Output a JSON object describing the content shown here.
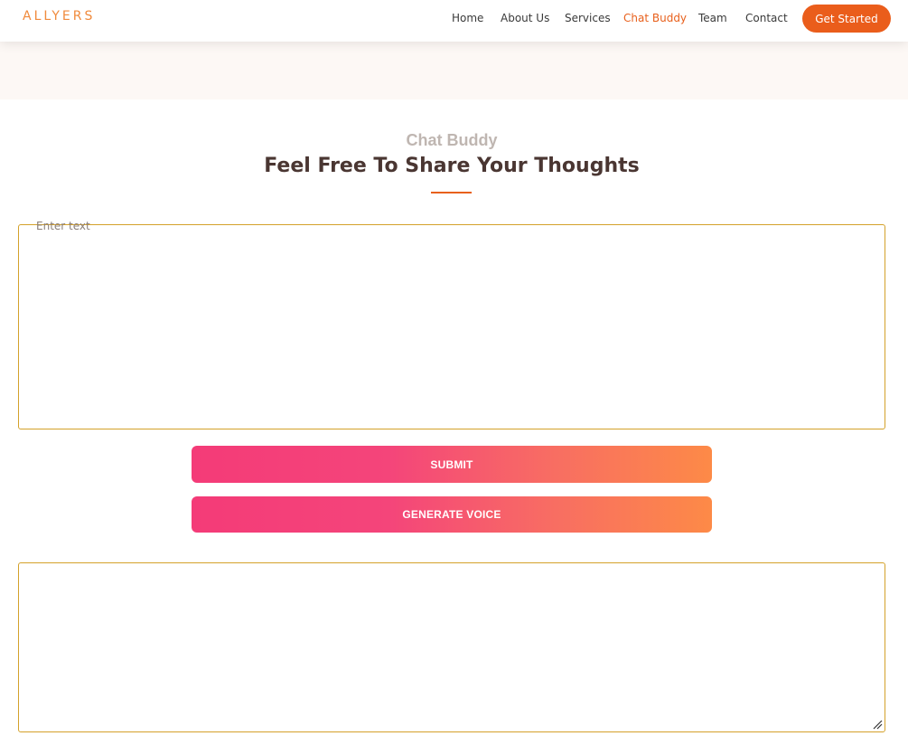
{
  "brand": {
    "logo_text": "ALLYERS",
    "accent_color": "#e8601c"
  },
  "nav": {
    "items": [
      {
        "label": "Home",
        "active": false
      },
      {
        "label": "About Us",
        "active": false
      },
      {
        "label": "Services",
        "active": false
      },
      {
        "label": "Chat Buddy",
        "active": true
      },
      {
        "label": "Team",
        "active": false
      },
      {
        "label": "Contact",
        "active": false
      }
    ],
    "cta_label": "Get Started"
  },
  "section": {
    "subtitle": "Chat Buddy",
    "title": "Feel Free To Share Your Thoughts"
  },
  "input": {
    "placeholder": "Enter text",
    "value": ""
  },
  "buttons": {
    "submit_label": "SUBMIT",
    "voice_label": "GENERATE VOICE"
  },
  "output": {
    "value": ""
  },
  "colors": {
    "button_gradient_start": "#f43b78",
    "button_gradient_end": "#fd8a47",
    "box_border": "#d4a12a",
    "title_color": "#4a3632",
    "subtitle_color": "#bfb6b1"
  }
}
